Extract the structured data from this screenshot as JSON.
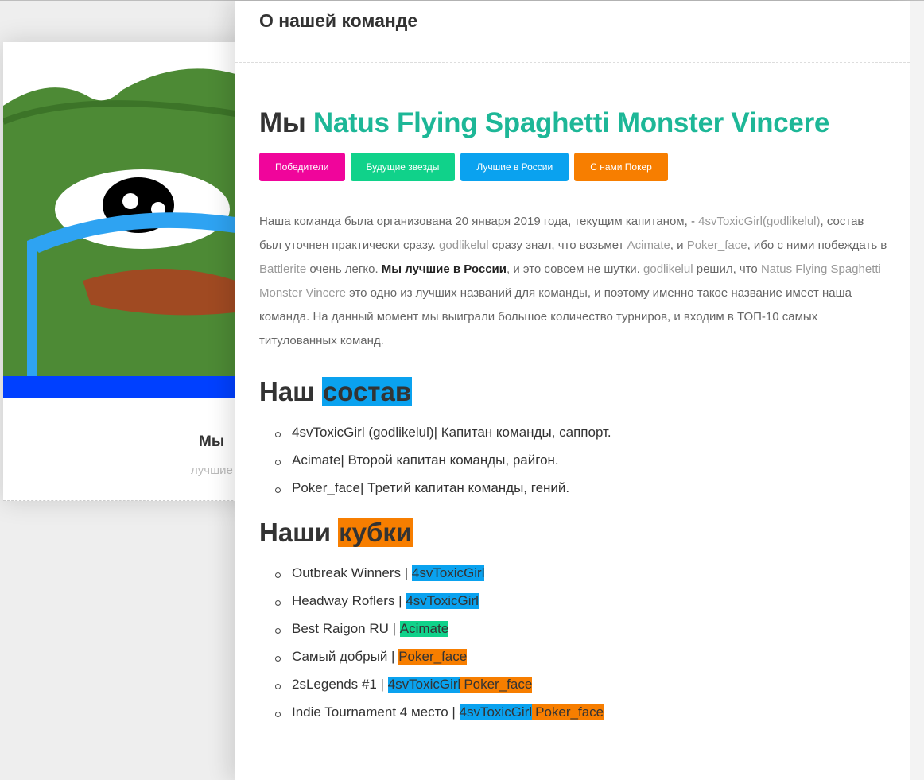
{
  "card": {
    "title": "Мы",
    "subtitle": "лучшие"
  },
  "modal": {
    "title": "О нашей команде",
    "heading_prefix": "Мы",
    "heading_team": "Natus Flying Spaghetti Monster Vincere",
    "buttons": [
      {
        "label": "Победители",
        "color": "#f0059b"
      },
      {
        "label": "Будущие звезды",
        "color": "#10d28a"
      },
      {
        "label": "Лучшие в России",
        "color": "#0aa2ef"
      },
      {
        "label": "С нами Покер",
        "color": "#f77e00"
      }
    ],
    "paragraph": {
      "t1": "Наша команда была организована 20 января 2019 года, текущим капитаном, - ",
      "n1": "4svToxicGirl(godlikelul)",
      "t2": ", состав был уточнен практически сразу. ",
      "n2": "godlikelul",
      "t3": " сразу знал, что возьмет ",
      "n3": "Acimate",
      "t4": ", и ",
      "n4": "Poker_face",
      "t5": ", ибо с ними побеждать в ",
      "n5": "Battlerite",
      "t6": " очень легко. ",
      "bold": "Мы лучшие в России",
      "t7": ", и это совсем не шутки. ",
      "n6": "godlikelul",
      "t8": " решил, что ",
      "n7": "Natus Flying Spaghetti Monster Vincere",
      "t9": " это одно из лучших названий для команды, и поэтому именно такое название имеет наша команда. На данный момент мы выиграли большое количество турниров, и входим в ТОП-10 самых титулованных команд."
    },
    "roster": {
      "title_a": "Наш",
      "title_b": "состав",
      "color": "#0aa2ef",
      "items": [
        {
          "name": "4svToxicGirl (godlikelul)",
          "role": " | Капитан команды, саппорт."
        },
        {
          "name": "Acimate",
          "role": " | Второй капитан команды, райгон."
        },
        {
          "name": "Poker_face",
          "role": " | Третий капитан команды, гений."
        }
      ]
    },
    "cups": {
      "title_a": "Наши",
      "title_b": "кубки",
      "color": "#f77e00",
      "items": [
        {
          "name": "Outbreak Winners | ",
          "tags": [
            "4svToxicGirl"
          ]
        },
        {
          "name": "Headway Roflers | ",
          "tags": [
            "4svToxicGirl"
          ]
        },
        {
          "name": "Best Raigon RU | ",
          "tags": [
            "Acimate"
          ]
        },
        {
          "name": "Самый добрый | ",
          "tags": [
            "Poker_face"
          ]
        },
        {
          "name": "2sLegends #1 | ",
          "tags": [
            "4svToxicGirl",
            "Poker_face"
          ]
        },
        {
          "name": "Indie Tournament 4 место | ",
          "tags": [
            "4svToxicGirl",
            "Poker_face"
          ]
        }
      ]
    },
    "tag_colors": {
      "4svToxicGirl": "#0aa2ef",
      "Acimate": "#10d28a",
      "Poker_face": "#f77e00"
    }
  }
}
